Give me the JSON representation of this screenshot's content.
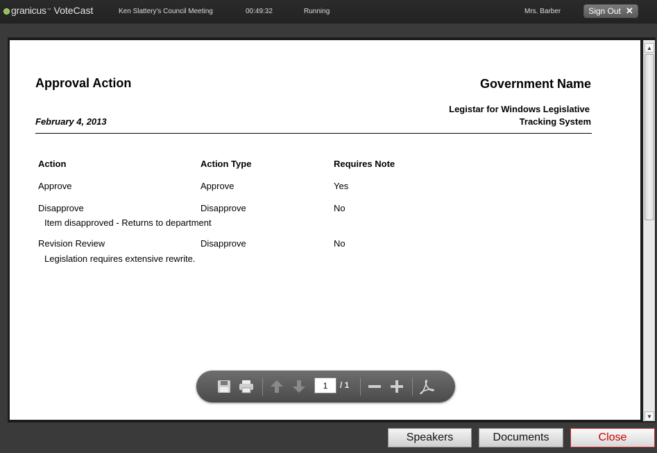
{
  "header": {
    "brand": "granicus",
    "product": "VoteCast",
    "meeting": "Ken Slattery's Council Meeting",
    "timer": "00:49:32",
    "status": "Running",
    "user": "Mrs. Barber",
    "sign_out": "Sign Out"
  },
  "document": {
    "title": "Approval Action",
    "government_name": "Government Name",
    "date": "February 4, 2013",
    "system_line1": "Legistar for Windows Legislative",
    "system_line2": "Tracking System",
    "columns": [
      "Action",
      "Action Type",
      "Requires Note"
    ],
    "rows": [
      {
        "action": "Approve",
        "type": "Approve",
        "requires_note": "Yes",
        "note": ""
      },
      {
        "action": "Disapprove",
        "type": "Disapprove",
        "requires_note": "No",
        "note": "Item disapproved - Returns to department"
      },
      {
        "action": "Revision Review",
        "type": "Disapprove",
        "requires_note": "No",
        "note": "Legislation requires extensive rewrite."
      }
    ]
  },
  "pdf_toolbar": {
    "page_current": "1",
    "page_total": "/ 1",
    "icons": [
      "save-icon",
      "print-icon",
      "arrow-up-icon",
      "arrow-down-icon",
      "zoom-out-icon",
      "zoom-in-icon",
      "acrobat-icon"
    ]
  },
  "buttons": {
    "speakers": "Speakers",
    "documents": "Documents",
    "close": "Close"
  },
  "colors": {
    "close_text": "#cc0000",
    "logo_green": "#8bc34a"
  }
}
